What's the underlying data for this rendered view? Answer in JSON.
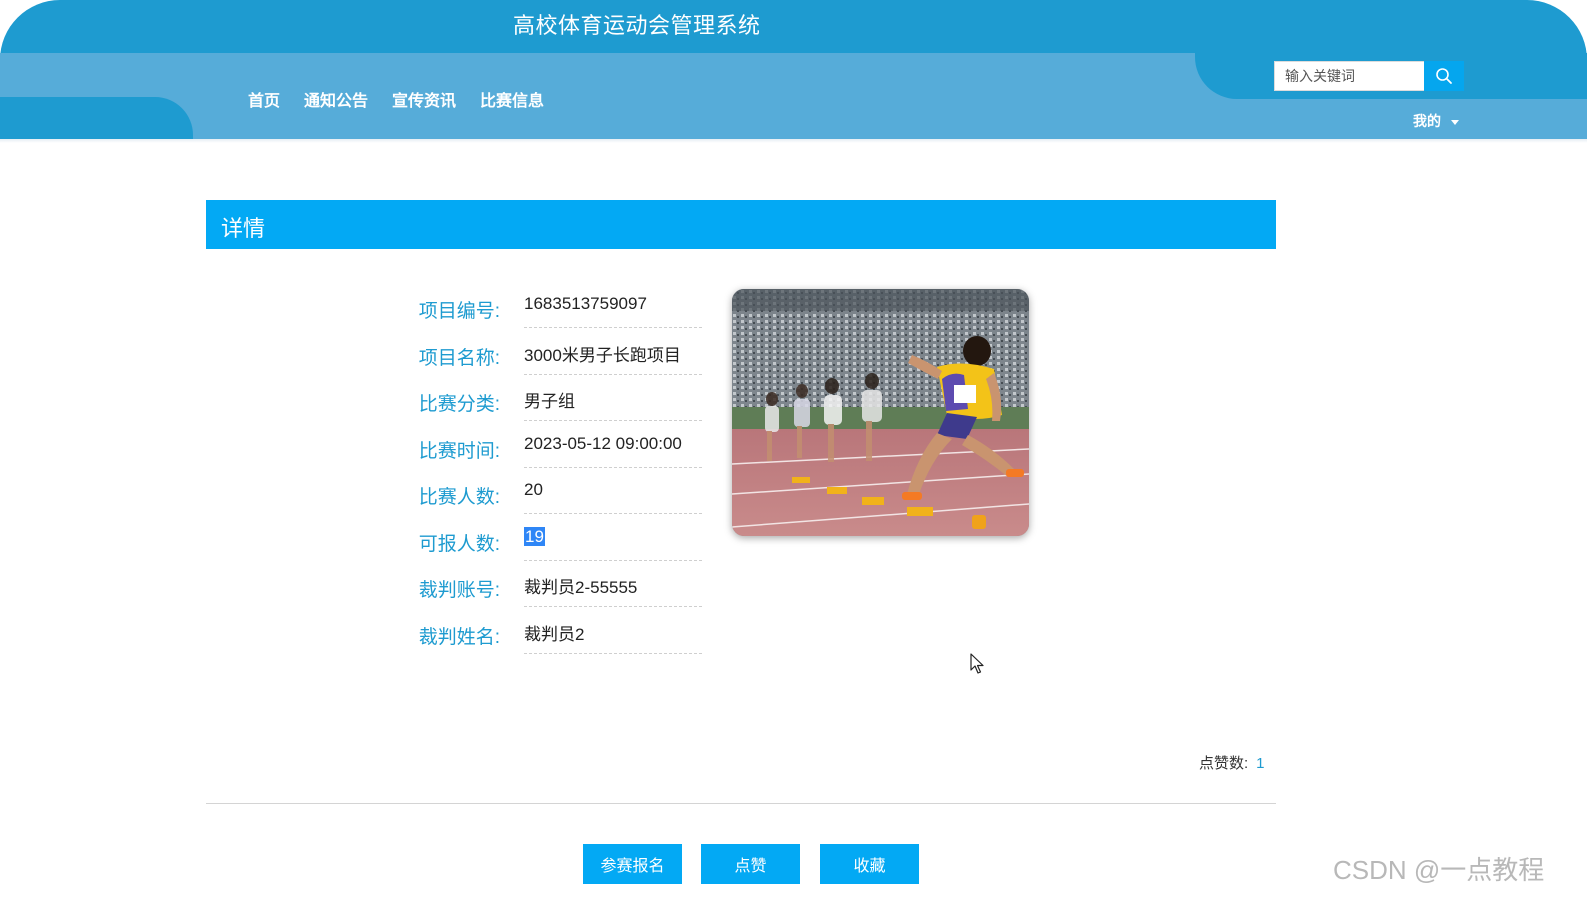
{
  "header": {
    "site_title": "高校体育运动会管理系统",
    "nav": [
      {
        "label": "首页"
      },
      {
        "label": "通知公告"
      },
      {
        "label": "宣传资讯"
      },
      {
        "label": "比赛信息"
      }
    ],
    "search": {
      "placeholder": "输入关键词",
      "value": ""
    },
    "user_menu": {
      "label": "我的"
    }
  },
  "detail": {
    "title": "详情",
    "fields": [
      {
        "label": "项目编号:",
        "value": "1683513759097"
      },
      {
        "label": "项目名称:",
        "value": "3000米男子长跑项目"
      },
      {
        "label": "比赛分类:",
        "value": "男子组"
      },
      {
        "label": "比赛时间:",
        "value": "2023-05-12 09:00:00"
      },
      {
        "label": "比赛人数:",
        "value": "20"
      },
      {
        "label": "可报人数:",
        "value": "19",
        "selected": true
      },
      {
        "label": "裁判账号:",
        "value": "裁判员2-55555"
      },
      {
        "label": "裁判姓名:",
        "value": "裁判员2"
      }
    ],
    "likes": {
      "label": "点赞数:",
      "count": "1"
    }
  },
  "actions": [
    {
      "label": "参赛报名"
    },
    {
      "label": "点赞"
    },
    {
      "label": "收藏"
    }
  ],
  "watermark": "CSDN @一点教程",
  "colors": {
    "header_dark": "#1e9bd0",
    "header_light": "#56acd9",
    "accent": "#03a9f4",
    "label": "#1e9bd0",
    "selection": "#2f86f6"
  }
}
